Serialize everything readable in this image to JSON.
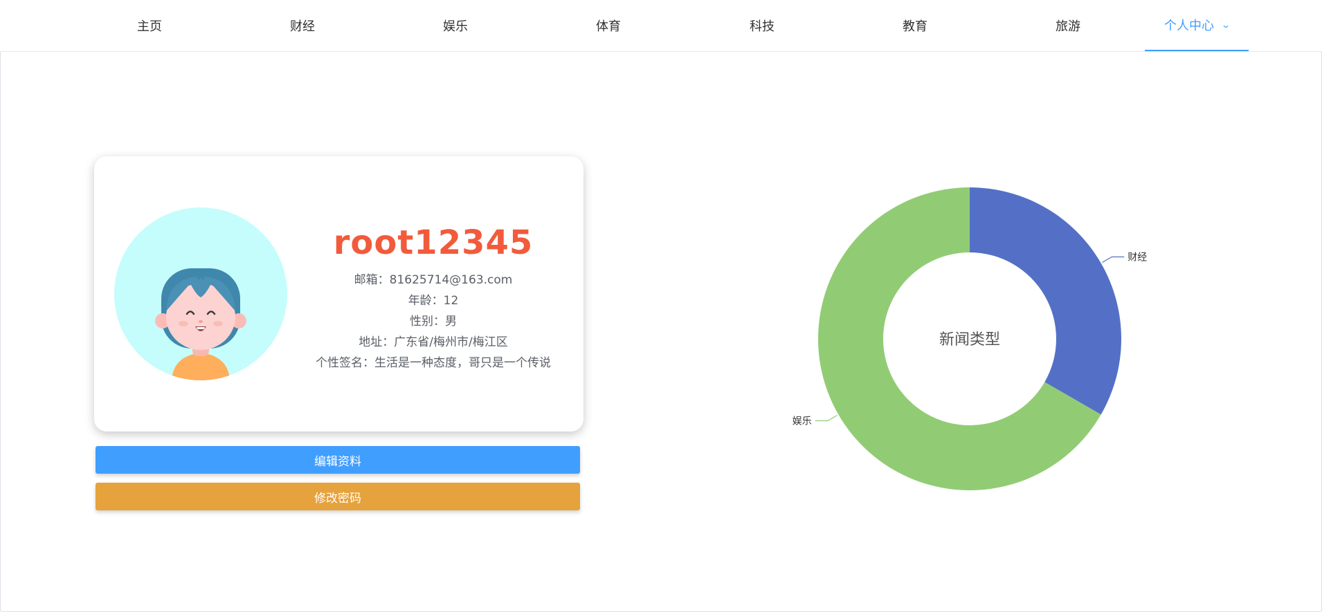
{
  "nav": {
    "items": [
      "主页",
      "财经",
      "娱乐",
      "体育",
      "科技",
      "教育",
      "旅游"
    ],
    "user_menu": "个人中心"
  },
  "profile": {
    "username": "root12345",
    "email": "邮箱：81625714@163.com",
    "age": "年龄：12",
    "gender": "性别：男",
    "address": "地址：广东省/梅州市/梅江区",
    "signature": "个性签名：生活是一种态度，哥只是一个传说"
  },
  "buttons": {
    "edit": "编辑资料",
    "password": "修改密码"
  },
  "colors": {
    "primary": "#409eff",
    "warning": "#e6a23c",
    "username": "#f15b3c",
    "avatar_bg": "#c4fdfc"
  },
  "chart_data": {
    "type": "pie",
    "style": "donut",
    "center_label": "新闻类型",
    "series": [
      {
        "name": "财经",
        "value": 1,
        "color": "#5470c6"
      },
      {
        "name": "娱乐",
        "value": 2,
        "color": "#91cc75"
      }
    ]
  }
}
